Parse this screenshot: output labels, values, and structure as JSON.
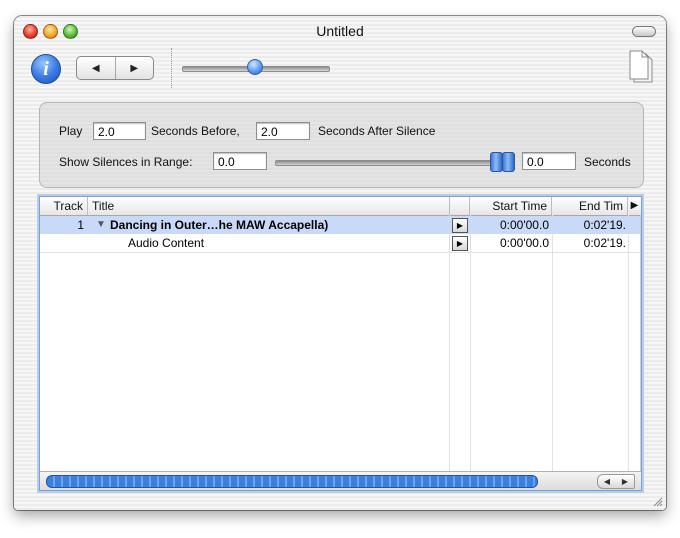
{
  "window": {
    "title": "Untitled"
  },
  "toolbar": {
    "info_label": "i",
    "back_glyph": "◀",
    "forward_glyph": "▶",
    "icons": [
      "info-icon",
      "back-arrow-icon",
      "forward-arrow-icon",
      "document-icon"
    ]
  },
  "settings": {
    "play_label": "Play",
    "before_value": "2.0",
    "before_label": "Seconds Before,",
    "after_value": "2.0",
    "after_label": "Seconds After Silence",
    "range_label": "Show Silences in Range:",
    "range_min_value": "0.0",
    "range_max_value": "0.0",
    "seconds_label": "Seconds"
  },
  "table": {
    "columns": [
      "Track",
      "Title",
      "Start Time",
      "End Tim"
    ],
    "header_arrow": "▶",
    "rows": [
      {
        "track": "1",
        "disclosure": "▼",
        "title": "Dancing in Outer…he MAW Accapella)",
        "start": "0:00'00.0",
        "end": "0:02'19.",
        "selected": true
      },
      {
        "track": "",
        "disclosure": "",
        "title": "Audio Content",
        "start": "0:00'00.0",
        "end": "0:02'19.",
        "selected": false
      }
    ],
    "play_glyph": "▶"
  },
  "scrollbar": {
    "left_glyph": "◀",
    "right_glyph": "▶"
  },
  "colors": {
    "selection": "#c9daf8",
    "aqua_blue": "#3d7fdc"
  }
}
